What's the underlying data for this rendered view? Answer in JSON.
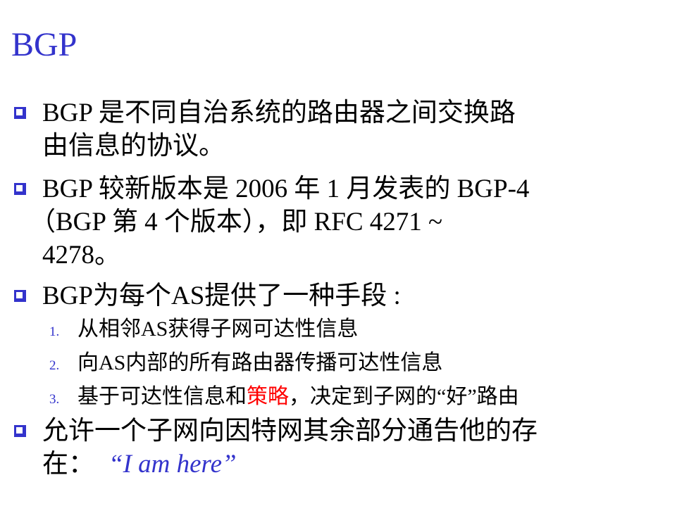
{
  "title": "BGP",
  "colors": {
    "accent": "#3333cc",
    "highlight": "#ff0000"
  },
  "bullets": [
    {
      "lines": [
        "BGP 是不同自治系统的路由器之间交换路",
        "由信息的协议。"
      ]
    },
    {
      "lines": [
        "BGP 较新版本是 2006 年 1 月发表的 BGP-4",
        "（BGP 第 4 个版本），即 RFC 4271 ~",
        "4278。"
      ]
    },
    {
      "lines": [
        "BGP为每个AS提供了一种手段 :"
      ]
    },
    {
      "lines": [
        "允许一个子网向因特网其余部分通告他的存",
        "在："
      ],
      "quote": "“I am here”"
    }
  ],
  "sub_items": [
    {
      "num": "1.",
      "text": "从相邻AS获得子网可达性信息"
    },
    {
      "num": "2.",
      "text": "向AS内部的所有路由器传播可达性信息"
    },
    {
      "num": "3.",
      "text_before": "基于可达性信息和",
      "text_highlight": "策略",
      "text_after": "，决定到子网的“好”路由"
    }
  ]
}
